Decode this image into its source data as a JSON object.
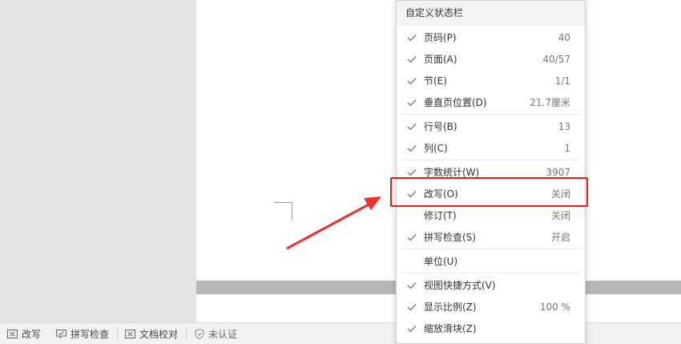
{
  "menu": {
    "title": "自定义状态栏",
    "groups": [
      [
        {
          "label": "页码(P)",
          "value": "40",
          "checked": true
        },
        {
          "label": "页面(A)",
          "value": "40/57",
          "checked": true
        },
        {
          "label": "节(E)",
          "value": "1/1",
          "checked": true
        },
        {
          "label": "垂直页位置(D)",
          "value": "21.7厘米",
          "checked": true
        }
      ],
      [
        {
          "label": "行号(B)",
          "value": "13",
          "checked": true
        },
        {
          "label": "列(C)",
          "value": "1",
          "checked": true
        }
      ],
      [
        {
          "label": "字数统计(W)",
          "value": "3907",
          "checked": true
        },
        {
          "label": "改写(O)",
          "value": "关闭",
          "checked": true
        },
        {
          "label": "修订(T)",
          "value": "关闭",
          "checked": false
        },
        {
          "label": "拼写检查(S)",
          "value": "开启",
          "checked": true
        }
      ],
      [
        {
          "label": "单位(U)",
          "value": "",
          "checked": false
        }
      ],
      [
        {
          "label": "视图快捷方式(V)",
          "value": "",
          "checked": true
        },
        {
          "label": "显示比例(Z)",
          "value": "100 %",
          "checked": true
        },
        {
          "label": "缩放滑块(Z)",
          "value": "",
          "checked": true
        }
      ]
    ]
  },
  "statusbar": {
    "items": [
      {
        "label": "改写",
        "icon": "overwrite-icon"
      },
      {
        "label": "拼写检查",
        "icon": "spellcheck-icon"
      },
      {
        "label": "文档校对",
        "icon": "proofread-icon"
      },
      {
        "label": "未认证",
        "icon": "shield-icon"
      }
    ]
  },
  "colors": {
    "highlight": "#e02020",
    "arrow": "#e8332a"
  }
}
